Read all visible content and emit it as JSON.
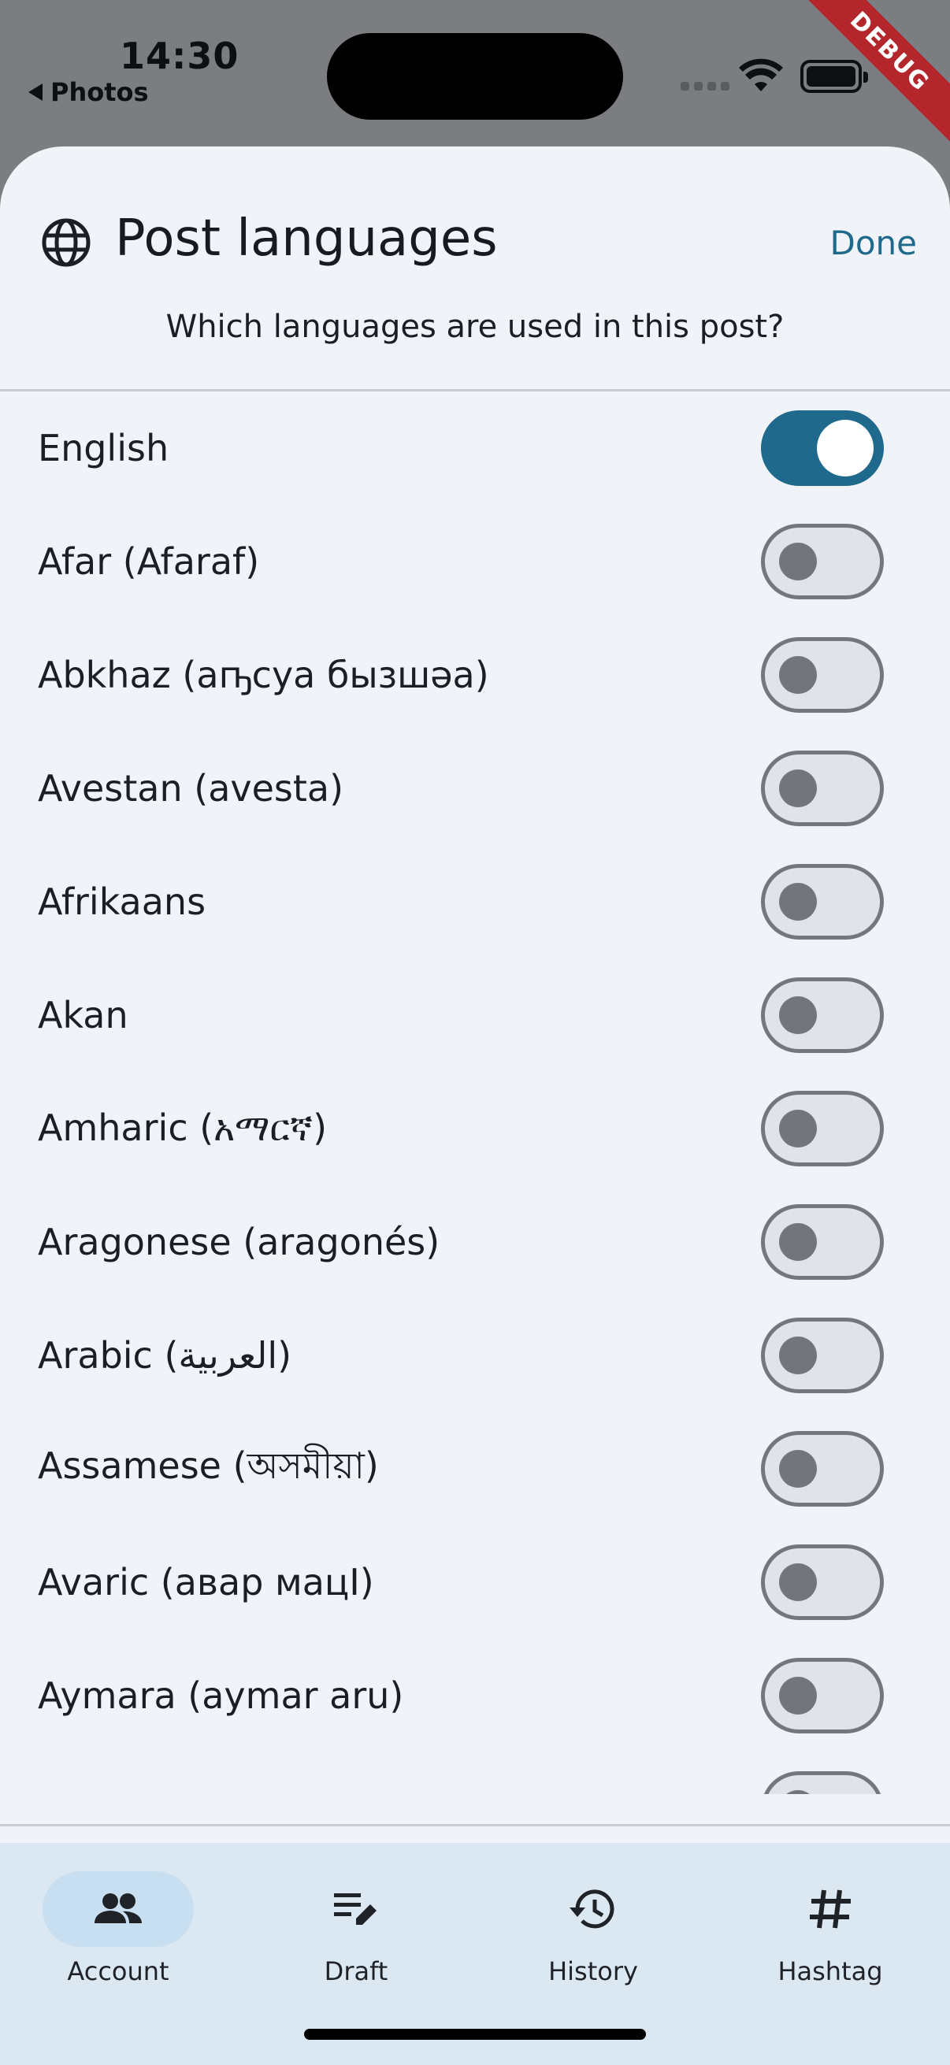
{
  "status_bar": {
    "time": "14:30",
    "back_label": "Photos",
    "debug_label": "DEBUG"
  },
  "sheet": {
    "title": "Post languages",
    "done_label": "Done",
    "subtitle": "Which languages are used in this post?",
    "languages": [
      {
        "label": "English",
        "enabled": true
      },
      {
        "label": "Afar (Afaraf)",
        "enabled": false
      },
      {
        "label": "Abkhaz (аҧсуа бызшәа)",
        "enabled": false
      },
      {
        "label": "Avestan (avesta)",
        "enabled": false
      },
      {
        "label": "Afrikaans",
        "enabled": false
      },
      {
        "label": "Akan",
        "enabled": false
      },
      {
        "label": "Amharic (አማርኛ)",
        "enabled": false
      },
      {
        "label": "Aragonese (aragonés)",
        "enabled": false
      },
      {
        "label": "Arabic (العربية)",
        "enabled": false
      },
      {
        "label": "Assamese (অসমীয়া)",
        "enabled": false
      },
      {
        "label": "Avaric (авар мацІ)",
        "enabled": false
      },
      {
        "label": "Aymara (aymar aru)",
        "enabled": false
      },
      {
        "label": "",
        "enabled": false
      }
    ]
  },
  "bottom_nav": [
    {
      "label": "Account",
      "icon": "people-icon",
      "active": true
    },
    {
      "label": "Draft",
      "icon": "edit-note-icon",
      "active": false
    },
    {
      "label": "History",
      "icon": "history-icon",
      "active": false
    },
    {
      "label": "Hashtag",
      "icon": "hashtag-icon",
      "active": false
    }
  ],
  "colors": {
    "accent": "#1f6a8c",
    "sheet_bg": "#f0f3f8",
    "nav_bg": "#dce8f1",
    "nav_active_pill": "#c7dff0",
    "debug_banner": "#b3262b"
  }
}
